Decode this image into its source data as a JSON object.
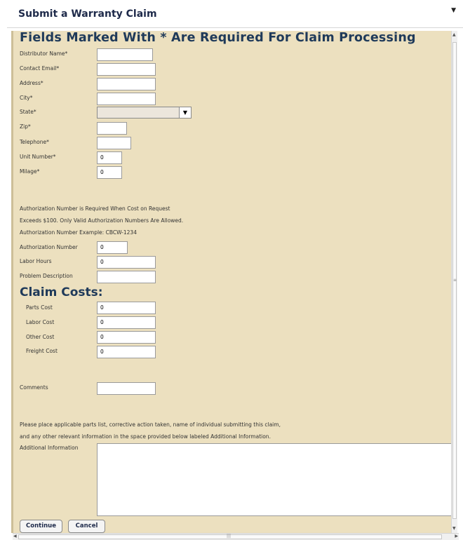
{
  "dialog": {
    "title": "Submit a Warranty Claim",
    "caret_icon": "▼"
  },
  "form": {
    "heading": "Fields Marked With * Are Required For Claim Processing",
    "fields": {
      "distributor_name": {
        "label": "Distributor Name*",
        "value": ""
      },
      "contact_email": {
        "label": "Contact Email*",
        "value": ""
      },
      "address": {
        "label": "Address*",
        "value": ""
      },
      "city": {
        "label": "City*",
        "value": ""
      },
      "state": {
        "label": "State*",
        "value": ""
      },
      "zip": {
        "label": "Zip*",
        "value": ""
      },
      "telephone": {
        "label": "Telephone*",
        "value": ""
      },
      "unit_number": {
        "label": "Unit Number*",
        "value": "0"
      },
      "milage": {
        "label": "Milage*",
        "value": "0"
      }
    },
    "auth_note": [
      "Authorization Number is Required When Cost on Request",
      "Exceeds $100. Only Valid Authorization Numbers Are Allowed.",
      "Authorization Number Example: CBCW-1234"
    ],
    "auth_fields": {
      "authorization_number": {
        "label": "Authorization Number",
        "value": "0"
      },
      "labor_hours": {
        "label": "Labor Hours",
        "value": "0"
      },
      "problem_description": {
        "label": "Problem Description",
        "value": ""
      }
    },
    "claim_costs": {
      "heading": "Claim Costs:",
      "parts_cost": {
        "label": "Parts Cost",
        "value": "0"
      },
      "labor_cost": {
        "label": "Labor Cost",
        "value": "0"
      },
      "other_cost": {
        "label": "Other Cost",
        "value": "0"
      },
      "freight_cost": {
        "label": "Freight Cost",
        "value": "0"
      }
    },
    "comments": {
      "label": "Comments",
      "value": ""
    },
    "parts_note": [
      "Please place applicable parts list, corrective action taken, name of individual submitting this claim,",
      "and any other relevant information in the space provided below labeled Additional Information."
    ],
    "additional_information": {
      "label": "Additional Information",
      "value": ""
    },
    "buttons": {
      "continue": "Continue",
      "cancel": "Cancel"
    }
  },
  "scrollbars": {
    "up_icon": "▲",
    "down_icon": "▼",
    "left_icon": "◀",
    "right_icon": "▶",
    "grip": "≡",
    "hgrip": "|||"
  },
  "colors": {
    "form_background": "#ece0bf",
    "heading": "#1f3a5a",
    "title": "#1e2a4a"
  }
}
